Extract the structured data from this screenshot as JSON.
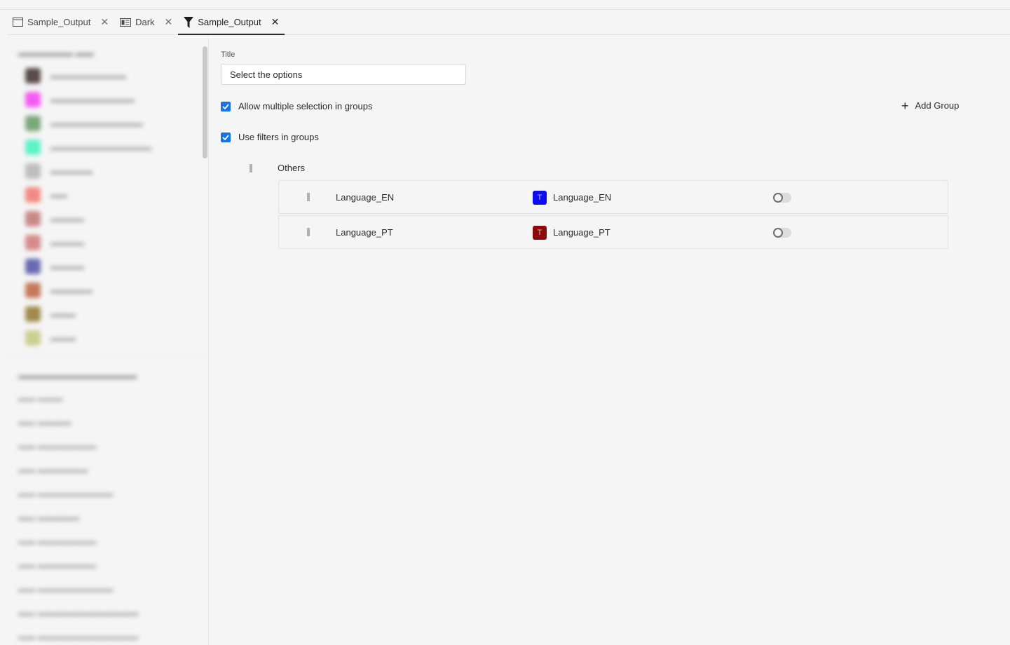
{
  "tabs": [
    {
      "label": "Sample_Output",
      "icon": "window-icon",
      "active": false
    },
    {
      "label": "Dark",
      "icon": "layout-icon",
      "active": false
    },
    {
      "label": "Sample_Output",
      "icon": "filter-icon",
      "active": true
    }
  ],
  "tab_close_glyph": "✕",
  "main": {
    "title_label": "Title",
    "title_value": "Select the options",
    "allow_multiple_label": "Allow multiple selection in groups",
    "use_filters_label": "Use filters in groups",
    "add_group_plus": "+",
    "add_group_label": "Add Group",
    "group": {
      "name": "Others",
      "options": [
        {
          "name": "Language_EN",
          "label": "Language_EN",
          "color": "#0d0df2",
          "glyph": "T",
          "enabled": false
        },
        {
          "name": "Language_PT",
          "label": "Language_PT",
          "color": "#8b0a0a",
          "glyph": "T",
          "enabled": false
        }
      ]
    }
  },
  "sidebar_obscured": {
    "section1_swatches": [
      "#5a4a4a",
      "#f25cf2",
      "#7aa77a",
      "#5ef2c8",
      "#bdbdbd",
      "#f28a84",
      "#c98a8a",
      "#d68a8a",
      "#6a6ab0",
      "#c47a5a",
      "#a08a4a",
      "#c8d090"
    ]
  }
}
